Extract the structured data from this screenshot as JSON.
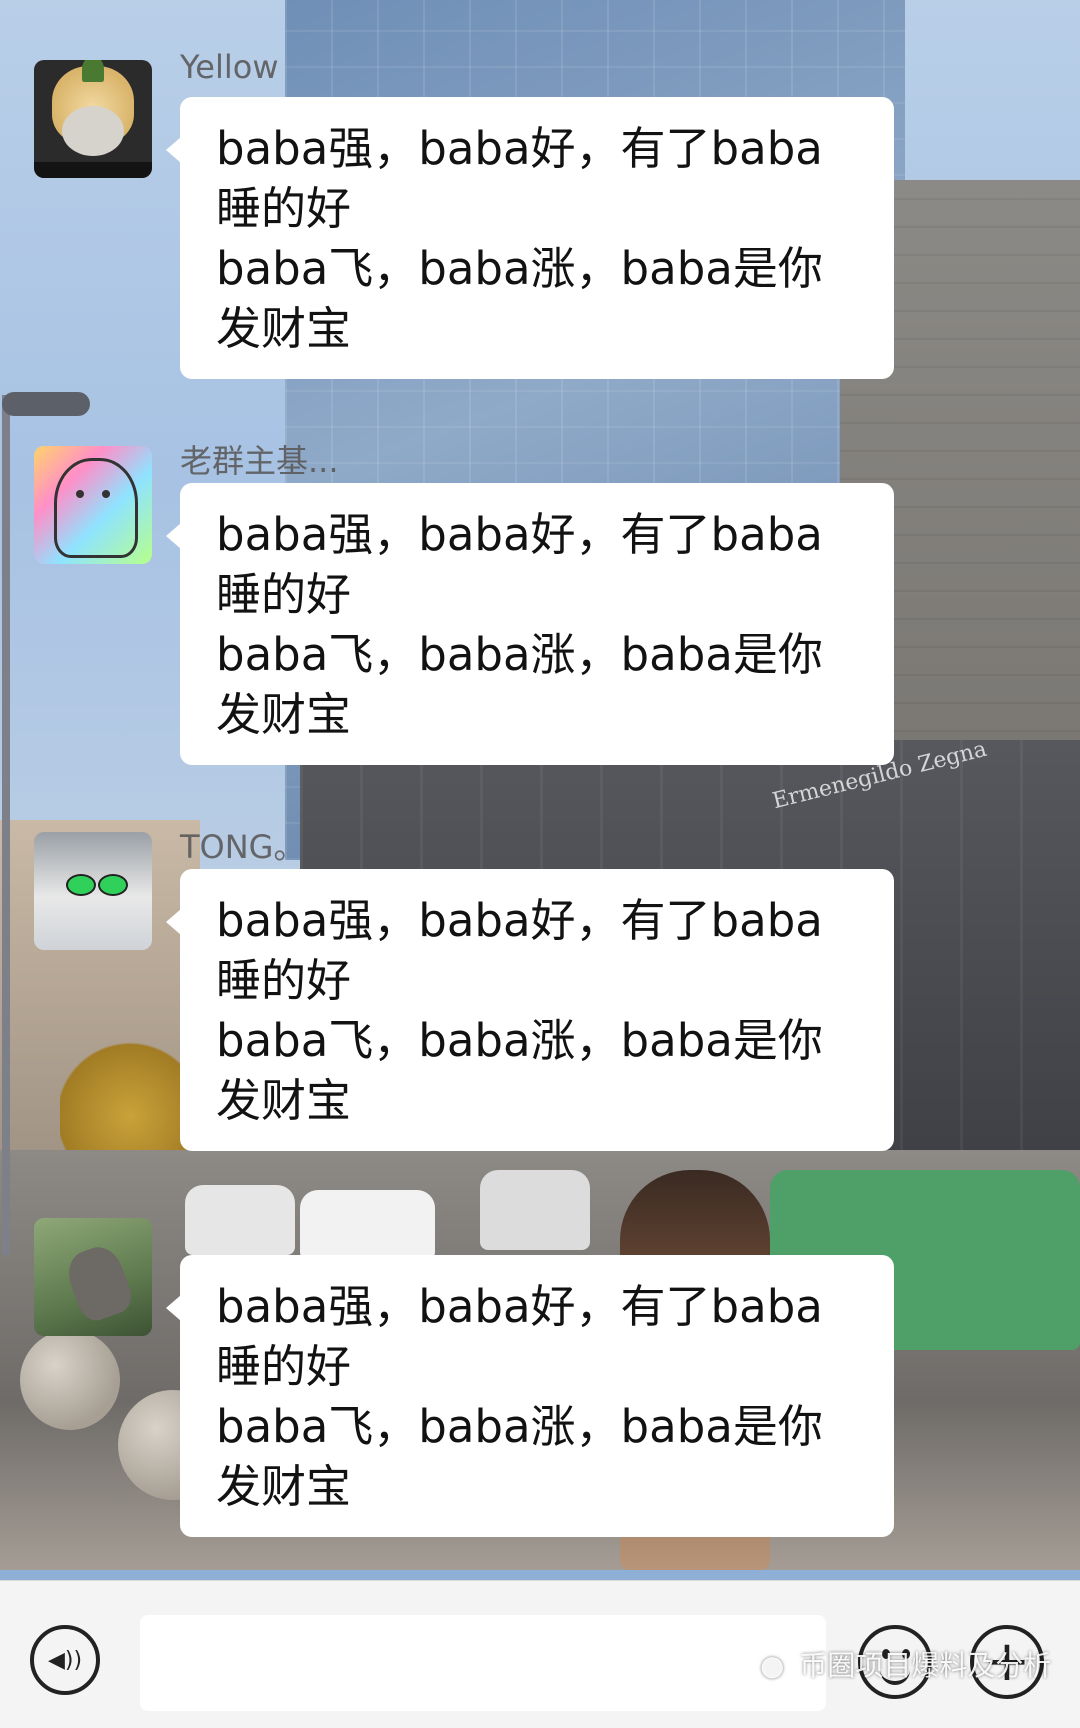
{
  "background": {
    "store_sign": "Ermenegildo Zegna"
  },
  "messages": [
    {
      "sender": "Yellow",
      "lines": [
        "baba强，baba好，有了baba",
        "睡的好",
        "baba飞，baba涨，baba是你",
        "发财宝"
      ]
    },
    {
      "sender": "老群主基...",
      "lines": [
        "baba强，baba好，有了baba",
        "睡的好",
        "baba飞，baba涨，baba是你",
        "发财宝"
      ]
    },
    {
      "sender": "TONG。",
      "lines": [
        "baba强，baba好，有了baba",
        "睡的好",
        "baba飞，baba涨，baba是你",
        "发财宝"
      ]
    },
    {
      "sender": "",
      "lines": [
        "baba强，baba好，有了baba",
        "睡的好",
        "baba飞，baba涨，baba是你",
        "发财宝"
      ]
    }
  ],
  "input_bar": {
    "voice_icon": "voice-icon",
    "emoji_icon": "emoji-icon",
    "plus_icon": "plus-icon",
    "plus_glyph": "+",
    "voice_glyph": "◀))",
    "placeholder": ""
  },
  "watermark": {
    "icon": "wechat-official-icon",
    "text": "币圈项目爆料及分析"
  },
  "colors": {
    "bubble": "#ffffff",
    "input_bar": "#f4f4f4",
    "text": "#121212"
  }
}
